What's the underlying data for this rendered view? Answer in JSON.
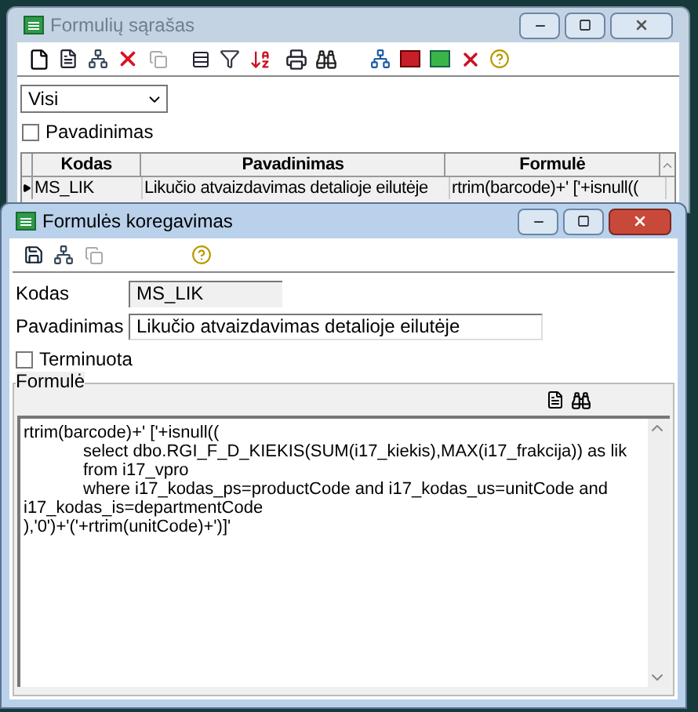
{
  "list_window": {
    "title": "Formulių sąrašas",
    "active": false,
    "filter": {
      "value": "Visi"
    },
    "name_filter": {
      "label": "Pavadinimas",
      "checked": false
    },
    "table": {
      "columns": [
        "Kodas",
        "Pavadinimas",
        "Formulė"
      ],
      "rows": [
        {
          "cells": [
            "MS_LIK",
            "Likučio atvaizdavimas detalioje eilutėje",
            "rtrim(barcode)+' ['+isnull(("
          ],
          "selected": true
        }
      ]
    }
  },
  "edit_window": {
    "title": "Formulės koregavimas",
    "active": true,
    "fields": [
      {
        "label": "Kodas",
        "value": "MS_LIK",
        "disabled": true
      },
      {
        "label": "Pavadinimas",
        "value": "Likučio atvaizdavimas detalioje eilutėje",
        "disabled": false
      }
    ],
    "timed": {
      "label": "Terminuota",
      "checked": false
    },
    "formula": {
      "label": "Formulė",
      "lines": [
        {
          "text": "rtrim(barcode)+' ['+isnull((",
          "indented": false
        },
        {
          "text": "select dbo.RGI_F_D_KIEKIS(SUM(i17_kiekis),MAX(i17_frakcija)) as lik",
          "indented": true
        },
        {
          "text": "from i17_vpro",
          "indented": true
        },
        {
          "text": "where i17_kodas_ps=productCode and i17_kodas_us=unitCode and",
          "indented": true
        },
        {
          "text": "i17_kodas_is=departmentCode",
          "indented": false
        },
        {
          "text": "),'0')+'('+rtrim(unitCode)+')]'",
          "indented": false
        }
      ]
    }
  }
}
